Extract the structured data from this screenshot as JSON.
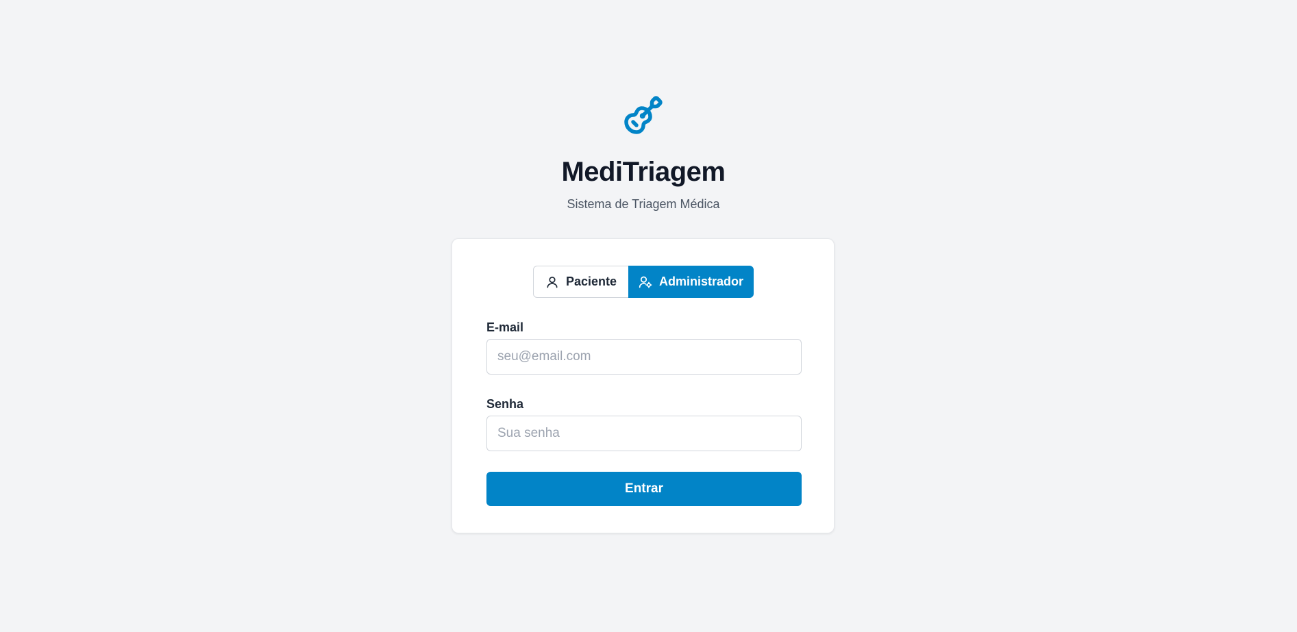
{
  "app": {
    "title": "MediTriagem",
    "subtitle": "Sistema de Triagem Médica",
    "logo_icon": "guitar-icon"
  },
  "role_toggle": {
    "patient_label": "Paciente",
    "patient_icon": "user-icon",
    "admin_label": "Administrador",
    "admin_icon": "user-cog-icon",
    "selected": "Administrador"
  },
  "form": {
    "email_label": "E-mail",
    "email_placeholder": "seu@email.com",
    "email_value": "",
    "password_label": "Senha",
    "password_placeholder": "Sua senha",
    "password_value": "",
    "submit_label": "Entrar"
  },
  "colors": {
    "accent": "#0284c7",
    "background": "#f3f4f6",
    "title": "#111827"
  }
}
